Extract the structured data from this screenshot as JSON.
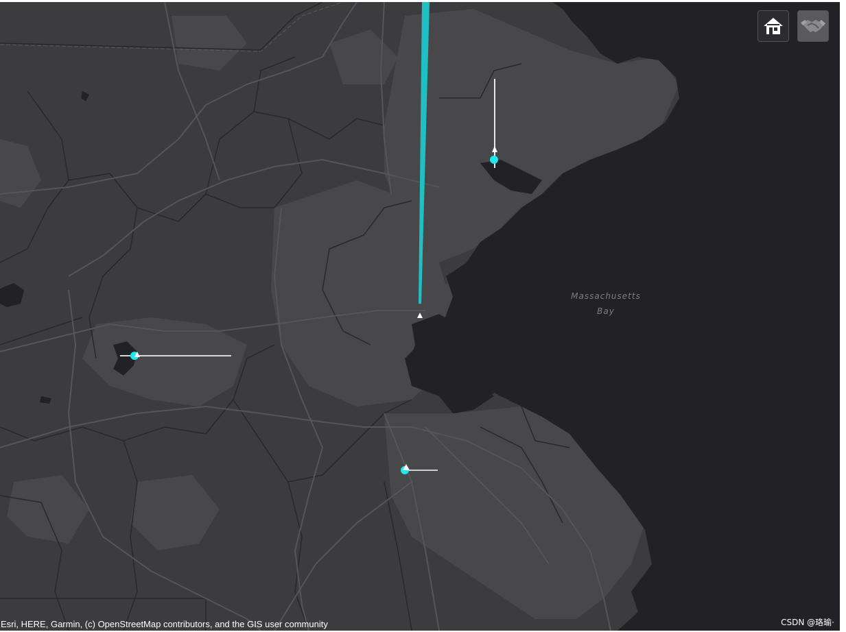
{
  "map": {
    "water_label_line1": "Massachusetts",
    "water_label_line2": "Bay",
    "attribution": "Esri, HERE, Garmin, (c) OpenStreetMap contributors, and the GIS user community",
    "watermark": "CSDN @珞瑜·",
    "colors": {
      "land": "#3c3c3f",
      "urban": "#48484b",
      "water": "#222125",
      "boundary": "#28282a",
      "road": "#56565a",
      "trail": "#1fbfc4",
      "marker": "#1ee6ec",
      "tail": "#e8e8e8"
    }
  },
  "controls": {
    "home_icon": "home-icon",
    "basemap_icon": "handshake-icon"
  }
}
